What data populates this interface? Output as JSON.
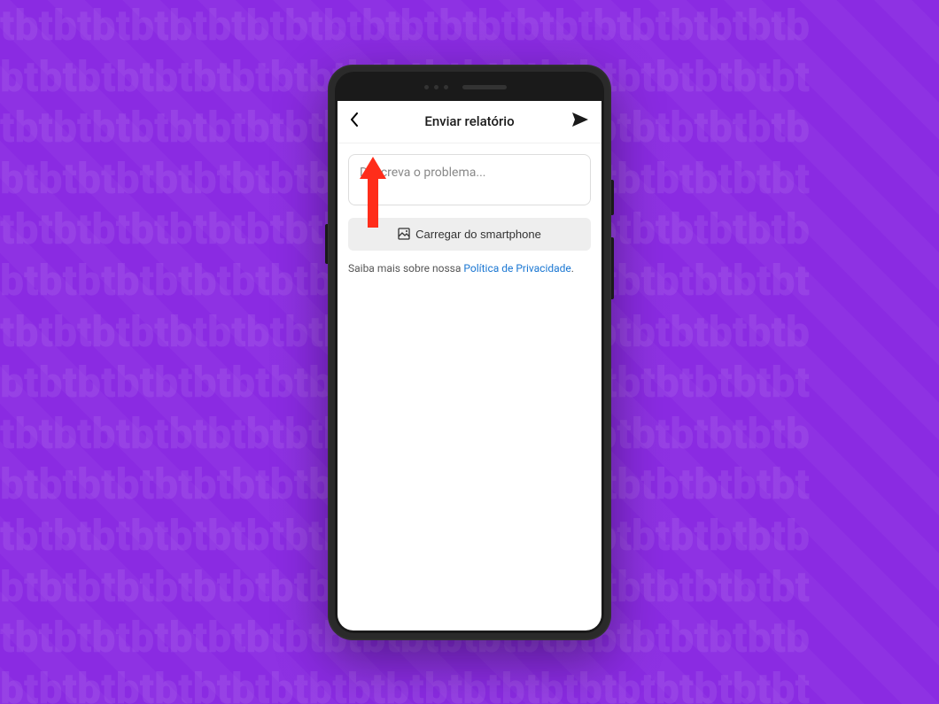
{
  "background": {
    "pattern_text": "tb"
  },
  "header": {
    "title": "Enviar relatório"
  },
  "form": {
    "description_placeholder": "Descreva o problema...",
    "upload_button_label": "Carregar do smartphone"
  },
  "privacy": {
    "prefix": "Saiba mais sobre nossa ",
    "link_text": "Política de Privacidade",
    "suffix": "."
  },
  "colors": {
    "background": "#8a2be2",
    "arrow": "#ff2d1a",
    "link": "#1976d2"
  }
}
